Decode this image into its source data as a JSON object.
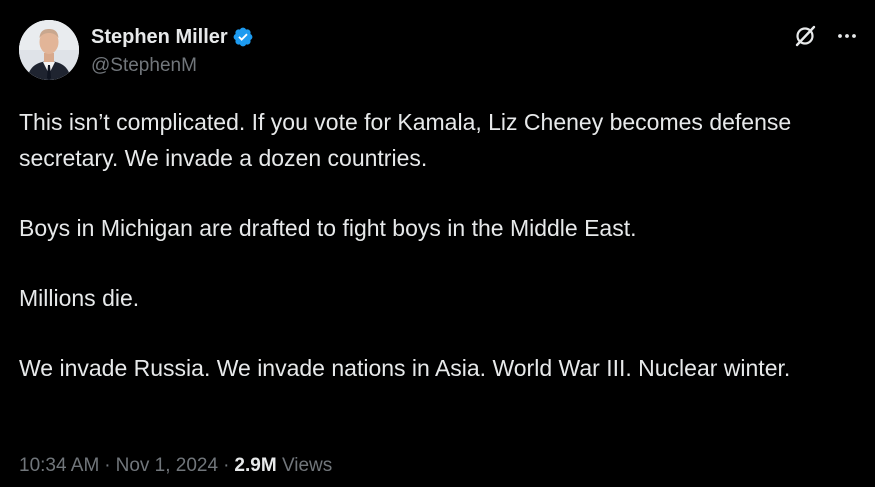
{
  "author": {
    "display_name": "Stephen Miller",
    "handle": "@StephenM",
    "verified": true
  },
  "icons": {
    "avatar": "profile-photo",
    "verified": "verified-badge-icon",
    "grok": "grok-icon",
    "more": "more-options-icon"
  },
  "colors": {
    "background": "#000000",
    "text": "#e7e9ea",
    "secondary_text": "#71767b",
    "verified": "#1d9bf0"
  },
  "tweet": {
    "paragraphs": [
      "This isn’t complicated. If you vote for Kamala, Liz Cheney becomes defense secretary. We invade a dozen countries.",
      "Boys in Michigan are drafted to fight boys in the Middle East.",
      "Millions die.",
      "We invade Russia. We invade nations in Asia. World War III. Nuclear winter."
    ]
  },
  "meta": {
    "time": "10:34 AM",
    "separator": "·",
    "date": "Nov 1, 2024",
    "views_count": "2.9M",
    "views_label": "Views"
  }
}
